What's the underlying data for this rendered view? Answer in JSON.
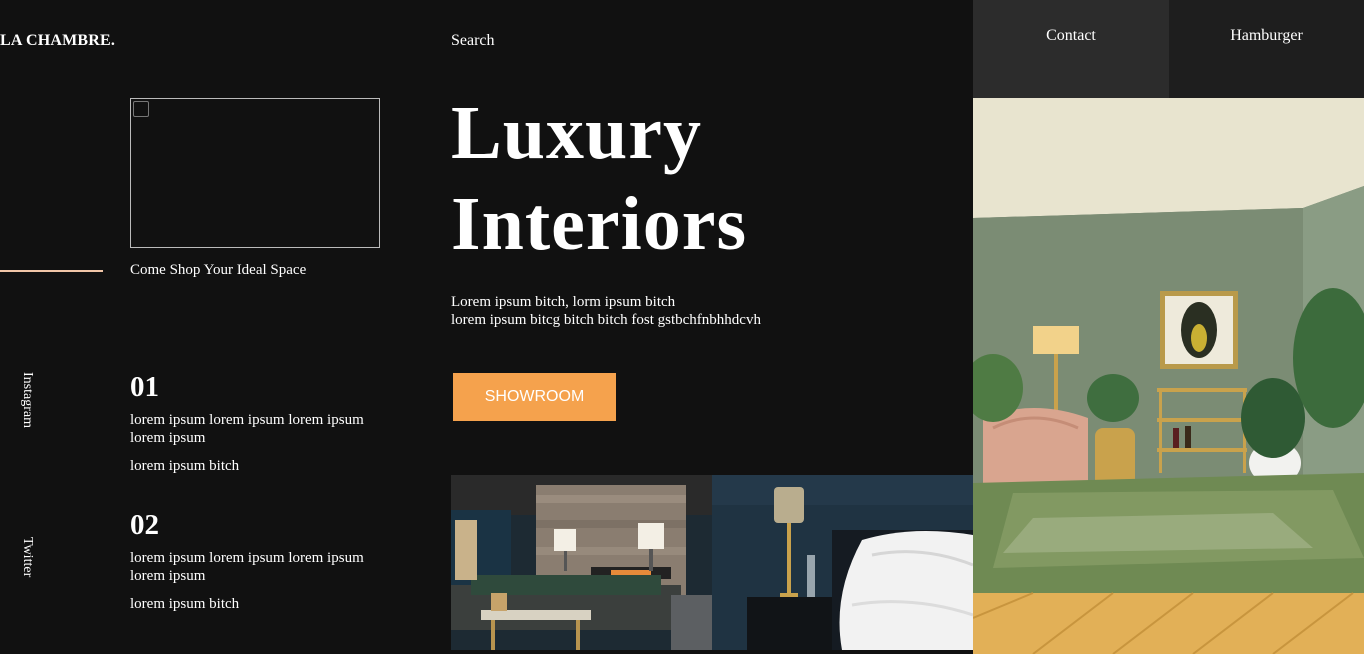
{
  "header": {
    "logo": "LA CHAMBRE.",
    "search_label": "Search",
    "nav": {
      "contact": "Contact",
      "hamburger": "Hamburger"
    }
  },
  "left": {
    "tagline": "Come Shop Your Ideal Space",
    "social": [
      "Instagram",
      "Twitter"
    ],
    "features": [
      {
        "number": "01",
        "text": "lorem ipsum lorem ipsum lorem ipsum lorem ipsum",
        "sub": "lorem ipsum bitch"
      },
      {
        "number": "02",
        "text": "lorem ipsum lorem ipsum lorem ipsum lorem ipsum",
        "sub": "lorem ipsum bitch"
      }
    ]
  },
  "hero": {
    "title_line1": "Luxury",
    "title_line2": "Interiors",
    "text_line1": "Lorem ipsum bitch, lorm ipsum bitch",
    "text_line2": "lorem ipsum bitcg bitch bitch fost gstbchfnbhhdcvh",
    "cta_label": "SHOWROOM"
  },
  "colors": {
    "background": "#111111",
    "accent": "#f5a24d",
    "accent_line": "#f2c6a8",
    "nav_contact_bg": "#2c2c2c",
    "nav_hamburger_bg": "#1e1e1e"
  }
}
